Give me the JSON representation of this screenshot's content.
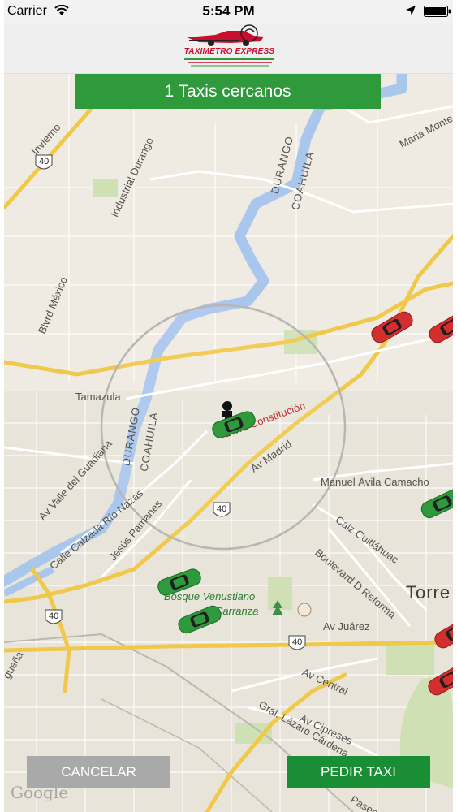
{
  "status_bar": {
    "carrier": "Carrier",
    "time": "5:54 PM",
    "icons": [
      "wifi-icon",
      "location-arrow-icon",
      "battery-icon"
    ]
  },
  "header": {
    "logo_text": "TAXIMETRO EXPRESS",
    "brand_color": "#c8102e"
  },
  "banner": {
    "text": "1 Taxis cercanos",
    "color": "#2f9a3c"
  },
  "map": {
    "watermark": "Google",
    "labels": {
      "invierno": "Invierno",
      "industrial_durango": "Industrial Durango",
      "durango_north": "DURANGO",
      "coahuila_north": "COAHUILA",
      "maria_montes": "Maria Monte",
      "blvrd_mexico": "Blvrd México",
      "tamazula": "Tamazula",
      "durango_west": "DURANGO",
      "coahuila_west": "COAHUILA",
      "blvrd_constitucion": "Blvrd Constitución",
      "av_madrid": "Av Madrid",
      "av_valle_guadiana": "Av Valle del Guadiana",
      "calle_calzada": "Calle Calzada Río Nazas",
      "jesus_pamanes": "Jesús Pamanes",
      "manuel_avila": "Manuel Ávila Camacho",
      "calz_cuitlahuac": "Calz Cuitláhuac",
      "boulevard_reforma": "Boulevard D Reforma",
      "torreon": "Torre",
      "bosque_1": "Bosque Venustiano",
      "bosque_2": "Carranza",
      "av_juarez": "Av Juárez",
      "av_central": "Av Central",
      "av_cipreses": "Av Cipreses",
      "gral_lazaro": "Gral. Lázaro Cárdena",
      "paseo": "Paseo",
      "guena": "gueña",
      "hwy_40_a": "40",
      "hwy_40_b": "40",
      "hwy_40_c": "40",
      "hwy_40_d": "40"
    }
  },
  "buttons": {
    "cancel": "CANCELAR",
    "order": "PEDIR TAXI"
  }
}
